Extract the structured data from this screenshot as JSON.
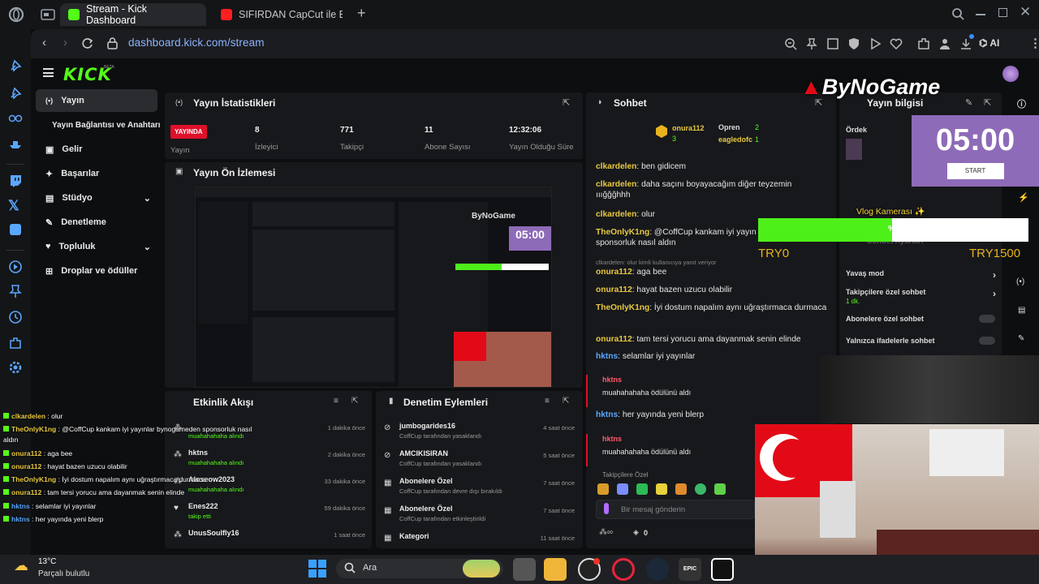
{
  "browser": {
    "tabs": [
      {
        "label": "Stream - Kick Dashboard",
        "active": true
      },
      {
        "label": "SIFIRDAN CapCut ile Edit N",
        "active": false
      }
    ],
    "url": "dashboard.kick.com/stream",
    "ai_label": "AI",
    "new_tab_label": "+"
  },
  "brand": {
    "logo": "KICK",
    "logo_sup": "BETA",
    "accent": "#53fc18"
  },
  "nav": {
    "items": [
      {
        "label": "Yayın",
        "icon": "broadcast-icon"
      },
      {
        "label": "Yayın Bağlantısı ve Anahtarı",
        "icon": ""
      },
      {
        "label": "Gelir",
        "icon": "money-icon"
      },
      {
        "label": "Başarılar",
        "icon": "trophy-icon"
      },
      {
        "label": "Stüdyo",
        "icon": "studio-icon"
      },
      {
        "label": "Denetleme",
        "icon": "wrench-icon"
      },
      {
        "label": "Topluluk",
        "icon": "community-icon"
      },
      {
        "label": "Droplar ve ödüller",
        "icon": "gift-icon"
      }
    ]
  },
  "stats": {
    "title": "Yayın İstatistikleri",
    "live_badge": "YAYINDA",
    "live_label": "Yayın",
    "items": [
      {
        "value": "8",
        "label": "İzleyici"
      },
      {
        "value": "771",
        "label": "Takipçi"
      },
      {
        "value": "11",
        "label": "Abone Sayısı"
      },
      {
        "value": "12:32:06",
        "label": "Yayın Olduğu Süre"
      }
    ]
  },
  "preview": {
    "title": "Yayın Ön İzlemesi",
    "timer": "05:00"
  },
  "activity": {
    "title": "Etkinlik Akışı",
    "items": [
      {
        "user": "",
        "desc": "muahahahaha alındı",
        "time": "1 dakika önce"
      },
      {
        "user": "hktns",
        "desc": "muahahahaha alındı",
        "time": "2 dakika önce"
      },
      {
        "user": "Aloseow2023",
        "desc": "muahahahaha alındı",
        "time": "33 dakika önce"
      },
      {
        "user": "Enes222",
        "desc": "takip etti",
        "time": "59 dakika önce"
      },
      {
        "user": "UnusSoulfly16",
        "desc": "",
        "time": "1 saat önce"
      }
    ]
  },
  "moderation": {
    "title": "Denetim Eylemleri",
    "items": [
      {
        "user": "jumbogarides16",
        "desc": "CoffCup tarafından yasaklandı",
        "time": "4 saat önce"
      },
      {
        "user": "AMCIKISIRAN",
        "desc": "CoffCup tarafından yasaklandı",
        "time": "5 saat önce"
      },
      {
        "user": "Abonelere Özel",
        "desc": "CoffCup tarafından devre dışı bırakıldı",
        "time": "7 saat önce"
      },
      {
        "user": "Abonelere Özel",
        "desc": "CoffCup tarafından etkinleştirildi",
        "time": "7 saat önce"
      },
      {
        "user": "Kategori",
        "desc": "",
        "time": "11 saat önce"
      }
    ]
  },
  "chat": {
    "title": "Sohbet",
    "top_users": [
      {
        "name": "onura112",
        "count": "3"
      },
      {
        "name": "Opren",
        "count": "2"
      },
      {
        "name": "eagledofc",
        "count": "1"
      }
    ],
    "messages": [
      {
        "user": "clkardelen",
        "text": "ben gidicem",
        "color": "#e8c940"
      },
      {
        "user": "clkardelen",
        "text": "daha saçını boyayacağım diğer teyzemin ııığğğhhh",
        "color": "#e8c940"
      },
      {
        "user": "clkardelen",
        "text": "olur",
        "color": "#e8c940"
      },
      {
        "user": "TheOnlyK1ng",
        "text": "@CoffCup kankam iyi yayın bynogameden sponsorluk nasıl aldın",
        "color": "#e8c940"
      },
      {
        "user": "onura112",
        "text": "aga bee",
        "color": "#e8c940"
      },
      {
        "user": "onura112",
        "text": "hayat bazen uzucu olabilir",
        "color": "#e8c940"
      },
      {
        "user": "TheOnlyK1ng",
        "text": "İyi dostum napalım aynı uğraştırmaca durmaca",
        "color": "#e8c940"
      },
      {
        "user": "onura112",
        "text": "tam tersi yorucu ama dayanmak senin elinde",
        "color": "#e8c940"
      },
      {
        "user": "hktns",
        "text": "selamlar iyi yayınlar",
        "color": "#5aa7ff"
      },
      {
        "user": "hktns",
        "text": "muahahahaha ödülünü aldı",
        "color": "#ff5a6e"
      },
      {
        "user": "hktns",
        "text": "her yayında yeni blerp",
        "color": "#5aa7ff"
      },
      {
        "user": "hktns",
        "text": "muahahahaha ödülünü aldı",
        "color": "#ff5a6e"
      }
    ],
    "reply_note": "clkardelen: olur kimli kullanıcıya yanıt veriyor",
    "followers_only": "Takipçilere Özel",
    "input_placeholder": "Bir mesaj gönderin",
    "bottom_count": "0"
  },
  "stream_info": {
    "title": "Yayın bilgisi",
    "sub": "Ördek",
    "settings_title": "Sohbet Ayarları",
    "settings": [
      {
        "label": "Yavaş mod",
        "type": "arrow"
      },
      {
        "label": "Takipçilere özel sohbet",
        "sub": "1 dk.",
        "type": "arrow"
      },
      {
        "label": "Abonelere özel sohbet",
        "type": "toggle"
      },
      {
        "label": "Yalnızca ifadelerle sohbet",
        "type": "toggle"
      }
    ]
  },
  "overlay": {
    "brand": "ByNoGame",
    "timer": "05:00",
    "start_label": "START",
    "goal_title": "Vlog Kamerası ✨",
    "goal_percent": "%49.67",
    "goal_progress": 0.4967,
    "goal_min": "TRY0",
    "goal_max": "TRY1500"
  },
  "obs_chat": [
    {
      "user": "clkardelen",
      "text": "olur"
    },
    {
      "user": "TheOnlyK1ng",
      "text": "@CoffCup kankam iyi yayınlar bynogameden sponsorluk nasıl aldın"
    },
    {
      "user": "onura112",
      "text": "aga bee"
    },
    {
      "user": "onura112",
      "text": "hayat bazen uzucu olabilir"
    },
    {
      "user": "TheOnlyK1ng",
      "text": "İyi dostum napalım aynı uğraştırmaca durmaca"
    },
    {
      "user": "onura112",
      "text": "tam tersi yorucu ama dayanmak senin elinde"
    },
    {
      "user": "hktns",
      "text": "selamlar iyi yayınlar"
    },
    {
      "user": "hktns",
      "text": "her yayında yeni blerp"
    }
  ],
  "taskbar": {
    "weather_temp": "13°C",
    "weather_desc": "Parçalı bulutlu",
    "search_label": "Ara"
  }
}
